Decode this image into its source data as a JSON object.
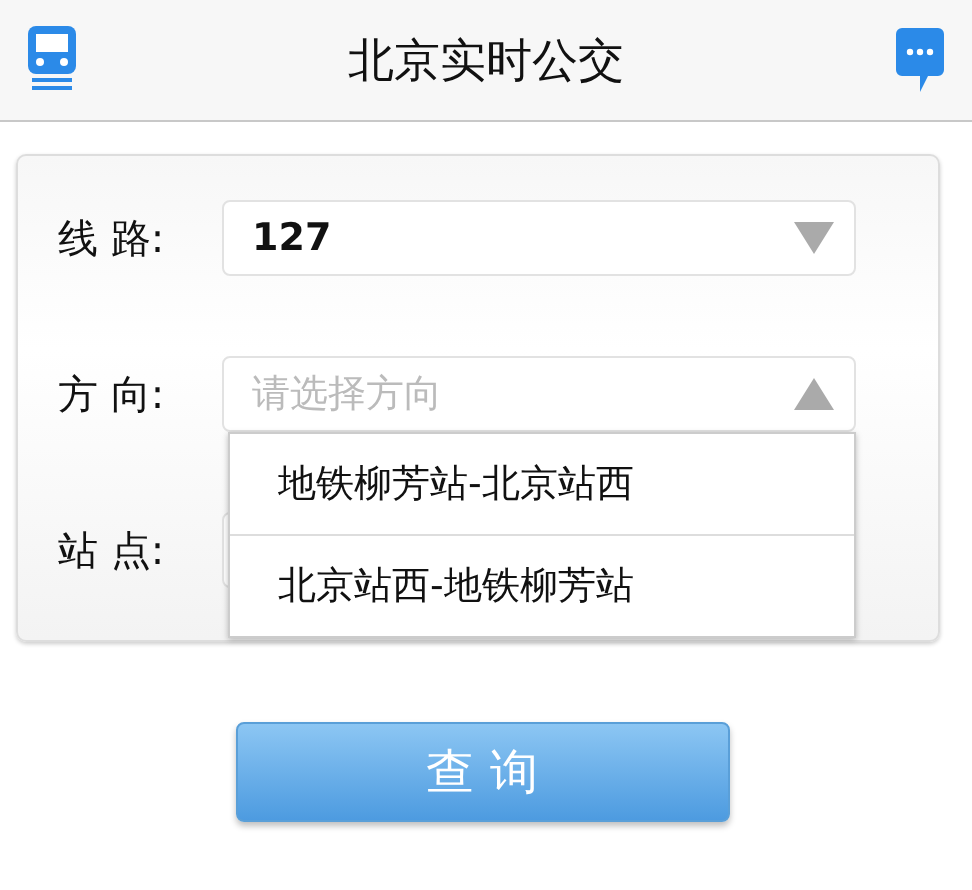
{
  "header": {
    "title": "北京实时公交"
  },
  "fields": [
    {
      "label": "线 路:",
      "value": "127",
      "expanded": false
    },
    {
      "label": "方 向:",
      "placeholder": "请选择方向",
      "expanded": true,
      "options": [
        "地铁柳芳站-北京站西",
        "北京站西-地铁柳芳站"
      ]
    },
    {
      "label": "站 点:",
      "expanded": false
    }
  ],
  "button": "查 询"
}
